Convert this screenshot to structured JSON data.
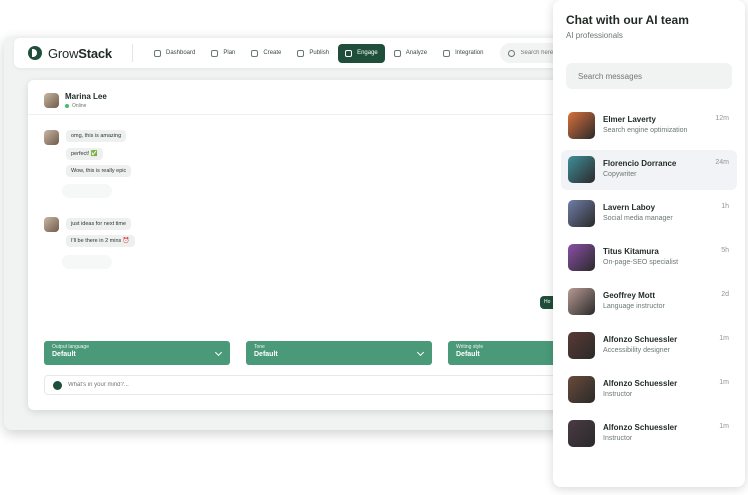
{
  "app": {
    "brand_light": "Grow",
    "brand_bold": "Stack"
  },
  "nav": [
    {
      "label": "Dashboard",
      "icon": "dashboard-icon"
    },
    {
      "label": "Plan",
      "icon": "plan-icon"
    },
    {
      "label": "Create",
      "icon": "pen-icon"
    },
    {
      "label": "Publish",
      "icon": "broadcast-icon"
    },
    {
      "label": "Engage",
      "icon": "engage-icon",
      "active": true
    },
    {
      "label": "Analyze",
      "icon": "chart-icon"
    },
    {
      "label": "Integration",
      "icon": "integration-icon"
    }
  ],
  "search": {
    "placeholder": "Search here..."
  },
  "chat": {
    "name": "Marina Lee",
    "status": "Online",
    "messages_a": [
      "omg, this is amazing",
      "perfect! ✅",
      "Wow, this is really epic"
    ],
    "messages_b": [
      "just ideas for next time",
      "I'll be there in 2 mins ⏰"
    ],
    "mine_preview": "Ho"
  },
  "dropdowns": [
    {
      "label": "Output language",
      "value": "Default"
    },
    {
      "label": "Tone",
      "value": "Default"
    },
    {
      "label": "Writing style",
      "value": "Default"
    }
  ],
  "composer": {
    "placeholder": "What's in your mind?..."
  },
  "panel": {
    "title": "Chat with our AI team",
    "subtitle": "AI professionals",
    "search_placeholder": "Search messages",
    "contacts": [
      {
        "name": "Elmer Laverty",
        "role": "Search engine optimization",
        "time": "12m",
        "avatar_color": "#d9703c"
      },
      {
        "name": "Florencio Dorrance",
        "role": "Copywriter",
        "time": "24m",
        "avatar_color": "#3f8f9a",
        "selected": true
      },
      {
        "name": "Lavern Laboy",
        "role": "Social media manager",
        "time": "1h",
        "avatar_color": "#6f7ea8"
      },
      {
        "name": "Titus Kitamura",
        "role": "On-page-SEO specialist",
        "time": "5h",
        "avatar_color": "#8a4fa8"
      },
      {
        "name": "Geoffrey Mott",
        "role": "Language instructor",
        "time": "2d",
        "avatar_color": "#b89a94"
      },
      {
        "name": "Alfonzo Schuessler",
        "role": "Accessibility designer",
        "time": "1m",
        "avatar_color": "#5a3a34"
      },
      {
        "name": "Alfonzo Schuessler",
        "role": "Instructor",
        "time": "1m",
        "avatar_color": "#6a4a3a"
      },
      {
        "name": "Alfonzo Schuessler",
        "role": "Instructor",
        "time": "1m",
        "avatar_color": "#4a3a44"
      }
    ]
  }
}
